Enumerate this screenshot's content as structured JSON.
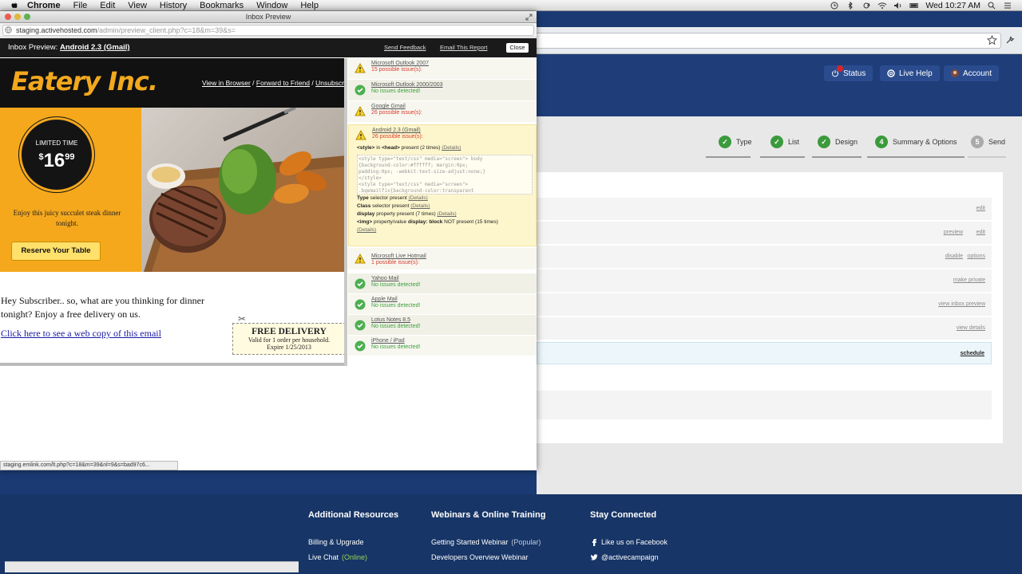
{
  "menubar": {
    "app": "Chrome",
    "items": [
      "File",
      "Edit",
      "View",
      "History",
      "Bookmarks",
      "Window",
      "Help"
    ],
    "clock": "Wed 10:27 AM"
  },
  "window": {
    "title": "Inbox Preview",
    "url_host": "staging.activehosted.com",
    "url_path": "/admin/preview_client.php?c=18&m=39&s=",
    "status_url": "staging.emlink.com/lt.php?c=18&m=39&nl=9&s=bad97c6..."
  },
  "preview_bar": {
    "label": "Inbox Preview:",
    "device": "Android 2.3 (Gmail)",
    "send_feedback": "Send Feedback",
    "email_report": "Email This Report",
    "close": "Close"
  },
  "email": {
    "logo": "Eatery Inc.",
    "view_browser": "View in Browser",
    "sep1": "/",
    "forward": "Forward to Friend",
    "sep2": "/",
    "unsubscribe": "Unsubscrib",
    "limited_time": "LIMITED TIME",
    "price_dollar": "$",
    "price_main": "16",
    "price_cents": "99",
    "tagline": "Enjoy this juicy succulet steak dinner tonight.",
    "reserve": "Reserve Your Table",
    "greeting": "Hey Subscriber.. so, what are you thinking for dinner tonight? Enjoy a free delivery on us.",
    "web_copy": "Click here to see a web copy of this email",
    "coupon_title": "FREE DELIVERY",
    "coupon_line": "Valid for 1 order per household.",
    "coupon_expire": "Expire 1/25/2013"
  },
  "report": {
    "clients": [
      {
        "name": "Microsoft Outlook 2007",
        "status": "15 possible issue(s):",
        "ok": false
      },
      {
        "name": "Microsoft Outlook 2000/2003",
        "status": "No issues detected!",
        "ok": true
      },
      {
        "name": "Google Gmail",
        "status": "26 possible issue(s):",
        "ok": false
      },
      {
        "name": "Android 2.3 (Gmail)",
        "status": "26 possible issue(s):",
        "ok": false
      },
      {
        "name": "Microsoft Live Hotmail",
        "status": "1 possible issue(s):",
        "ok": false
      },
      {
        "name": "Yahoo Mail",
        "status": "No issues detected!",
        "ok": true
      },
      {
        "name": "Apple Mail",
        "status": "No issues detected!",
        "ok": true
      },
      {
        "name": "Lotus Notes 8.5",
        "status": "No issues detected!",
        "ok": true
      },
      {
        "name": "iPhone / iPad",
        "status": "No issues detected!",
        "ok": true
      }
    ],
    "details": {
      "style_a": "<style>",
      "style_b": " in ",
      "style_c": "<head>",
      "style_d": " present (2 times) ",
      "details": "(Details)",
      "code": "<style type=\"text/css\" media=\"screen\"> body\n{background-color:#ffffff; margin:0px;\npadding:0px; -webkit-text-size-adjust:none;}\n</style>\n<style type=\"text/css\" media=\"screen\">\n.bqemailfix{background-color:transparent",
      "type_a": "Type",
      "type_b": " selector present ",
      "class_a": "Class",
      "class_b": " selector present ",
      "display_a": "display",
      "display_b": " property present (7 times) ",
      "img_a": "<img>",
      "img_b": " property/value ",
      "img_c": "display: block",
      "img_d": " NOT present (15 times)"
    }
  },
  "app": {
    "status": "Status",
    "live_help": "Live Help",
    "account": "Account",
    "steps": [
      {
        "num": "✓",
        "label": "Type"
      },
      {
        "num": "✓",
        "label": "List"
      },
      {
        "num": "✓",
        "label": "Design"
      },
      {
        "num": "4",
        "label": "Summary & Options"
      },
      {
        "num": "5",
        "label": "Send"
      }
    ],
    "rows": {
      "r1": "edit",
      "r2a": "preview",
      "r2b": "edit",
      "r3a": "disable",
      "r3b": "options",
      "r4": "make private",
      "r5": "view inbox preview",
      "r6": "view details",
      "r7": "schedule"
    }
  },
  "footer": {
    "col1_title": "Additional Resources",
    "col1_l1": "Billing & Upgrade",
    "col1_l2": "Live Chat",
    "col1_l2_extra": "(Online)",
    "col2_title": "Webinars & Online Training",
    "col2_l1": "Getting Started Webinar",
    "col2_l1_extra": "(Popular)",
    "col2_l2": "Developers Overview Webinar",
    "col3_title": "Stay Connected",
    "col3_l1": "Like us on Facebook",
    "col3_l2": "@activecampaign"
  },
  "colors": {
    "accent": "#f5a81c",
    "ok": "#3ea03e",
    "bad": "#d53b2c",
    "navy": "#1f3d78"
  }
}
